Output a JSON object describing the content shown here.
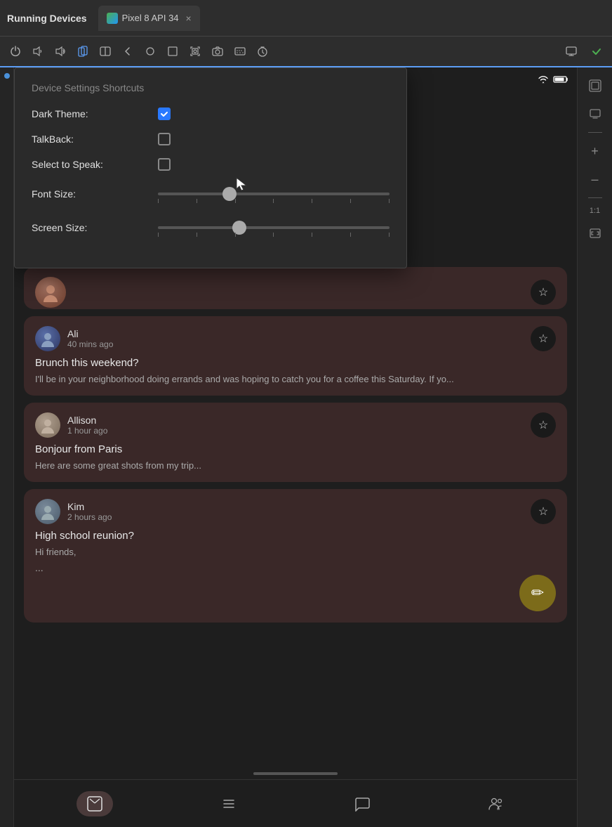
{
  "topBar": {
    "title": "Running Devices",
    "tab": {
      "label": "Pixel 8 API 34",
      "closeIcon": "×"
    }
  },
  "toolbar": {
    "icons": [
      "⏻",
      "🔊",
      "🔇",
      "📱",
      "◧",
      "◁",
      "○",
      "□",
      "📷",
      "🎥",
      "⌨",
      "⏱"
    ],
    "rightIcons": [
      "⊡",
      "✓"
    ]
  },
  "settingsPopup": {
    "title": "Device Settings Shortcuts",
    "darkTheme": {
      "label": "Dark Theme:",
      "checked": true
    },
    "talkback": {
      "label": "TalkBack:",
      "checked": false
    },
    "selectToSpeak": {
      "label": "Select to Speak:",
      "checked": false
    },
    "fontSize": {
      "label": "Font Size:",
      "value": 30
    },
    "screenSize": {
      "label": "Screen Size:",
      "value": 35
    }
  },
  "phone": {
    "statusBar": {
      "wifi": "▲",
      "battery": "🔋"
    },
    "cards": [
      {
        "id": "card-first",
        "sender": "",
        "time": "",
        "subject": "",
        "preview": "...",
        "partial": true
      },
      {
        "id": "card-ali",
        "sender": "Ali",
        "time": "40 mins ago",
        "subject": "Brunch this weekend?",
        "preview": "I'll be in your neighborhood doing errands and was hoping to catch you for a coffee this Saturday. If yo...",
        "avatarClass": "av-ali"
      },
      {
        "id": "card-allison",
        "sender": "Allison",
        "time": "1 hour ago",
        "subject": "Bonjour from Paris",
        "preview": "Here are some great shots from my trip...",
        "avatarClass": "av-allison"
      },
      {
        "id": "card-kim",
        "sender": "Kim",
        "time": "2 hours ago",
        "subject": "High school reunion?",
        "preview": "Hi friends,",
        "ellipsis": "...",
        "avatarClass": "av-kim"
      }
    ],
    "bottomNav": [
      {
        "id": "nav-mail",
        "icon": "⊟",
        "active": true
      },
      {
        "id": "nav-list",
        "icon": "☰",
        "active": false
      },
      {
        "id": "nav-chat",
        "icon": "💬",
        "active": false
      },
      {
        "id": "nav-people",
        "icon": "👥",
        "active": false
      }
    ],
    "fab": {
      "icon": "✏"
    }
  },
  "rightPanel": {
    "plus": "+",
    "minus": "–",
    "zoom": "1:1",
    "screenIcon": "⊡"
  }
}
